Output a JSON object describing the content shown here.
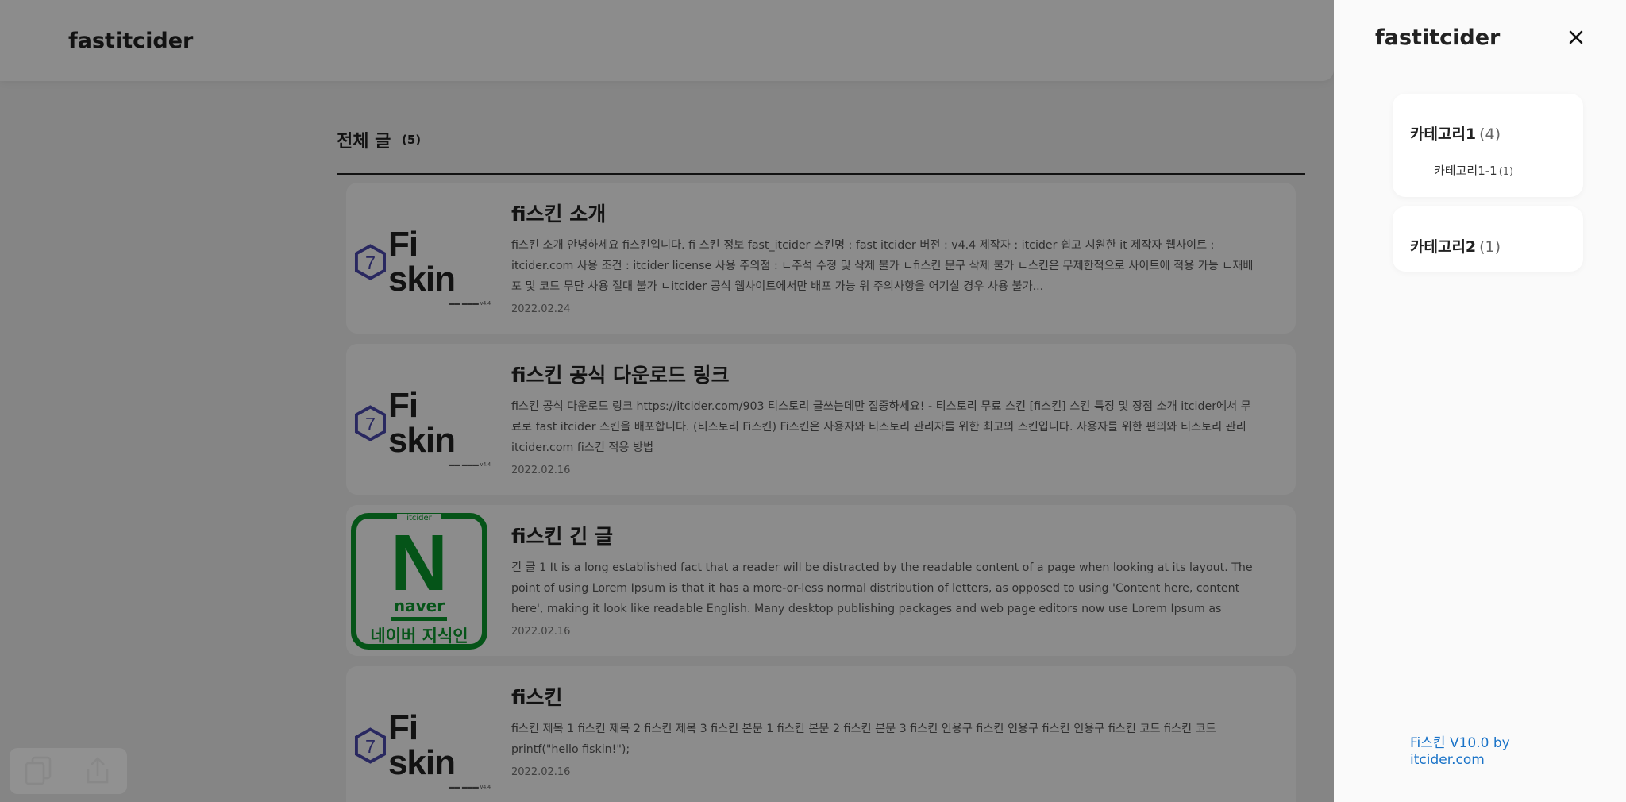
{
  "header": {
    "site_title": "fastitcider"
  },
  "list": {
    "title": "전체 글",
    "count": "(5)"
  },
  "posts": [
    {
      "thumb": "fiskin",
      "title": "fi스킨 소개",
      "excerpt": "fi스킨 소개 안녕하세요 fi스킨입니다. fi 스킨 정보 fast_itcider 스킨명 : fast itcider 버전 : v4.4 제작자 : itcider 쉽고 시원한 it 제작자 웹사이트 : itcider.com 사용 조건 : itcider license 사용 주의점 : ㄴ주석 수정 및 삭제 불가 ㄴfi스킨 문구 삭제 불가 ㄴ스킨은 무제한적으로 사이트에 적용 가능 ㄴ재배포 및 코드 무단 사용 절대 불가 ㄴitcider 공식 웹사이트에서만 배포 가능 위 주의사항을 어기실 경우 사용 불가...",
      "date": "2022.02.24"
    },
    {
      "thumb": "fiskin",
      "title": "fi스킨 공식 다운로드 링크",
      "excerpt": "fi스킨 공식 다운로드 링크 https://itcider.com/903 티스토리 글쓰는데만 집중하세요! - 티스토리 무료 스킨 [fi스킨] 스킨 특징 및 장점 소개 itcider에서 무료로 fast itcider 스킨을 배포합니다. (티스토리 Fi스킨) Fi스킨은 사용자와 티스토리 관리자를 위한 최고의 스킨입니다. 사용자를 위한 편의와 티스토리 관리 itcider.com fi스킨 적용 방법",
      "date": "2022.02.16"
    },
    {
      "thumb": "naver",
      "title": "fi스킨 긴 글",
      "excerpt": "긴 글 1 It is a long established fact that a reader will be distracted by the readable content of a page when looking at its layout. The point of using Lorem Ipsum is that it has a more-or-less normal distribution of letters, as opposed to using 'Content here, content here', making it look like readable English. Many desktop publishing packages and web page editors now use Lorem Ipsum as their...",
      "date": "2022.02.16"
    },
    {
      "thumb": "fiskin",
      "title": "fi스킨",
      "excerpt": "fi스킨 제목 1 fi스킨 제목 2 fi스킨 제목 3 fi스킨 본문 1 fi스킨 본문 2 fi스킨 본문 3 fi스킨 인용구 fi스킨 인용구 fi스킨 인용구 fi스킨 코드 fi스킨 코드 printf(\"hello fiskin!\");",
      "date": "2022.02.16"
    }
  ],
  "logos": {
    "fiskin": {
      "number": "7",
      "word": "Fi skin",
      "color": "#4b4ab0"
    },
    "naver": {
      "top": "itcider",
      "letter": "N",
      "word": "naver",
      "ko": "네이버 지식인",
      "color": "#0a9a2c"
    }
  },
  "floating_tools": [
    "copy-icon",
    "share-icon"
  ],
  "drawer": {
    "title": "fastitcider",
    "close_icon": "close-icon",
    "categories": [
      {
        "name": "카테고리1",
        "count": "(4)",
        "children": [
          {
            "name": "카테고리1-1",
            "count": "(1)"
          }
        ]
      },
      {
        "name": "카테고리2",
        "count": "(1)",
        "children": []
      }
    ],
    "credit": "Fi스킨 V10.0 by itcider.com"
  },
  "colors": {
    "overlay": "rgba(0,0,0,0.45)",
    "link": "#1a73c8",
    "naver_green": "#0a9a2c",
    "fiskin_purple": "#4b4ab0"
  }
}
